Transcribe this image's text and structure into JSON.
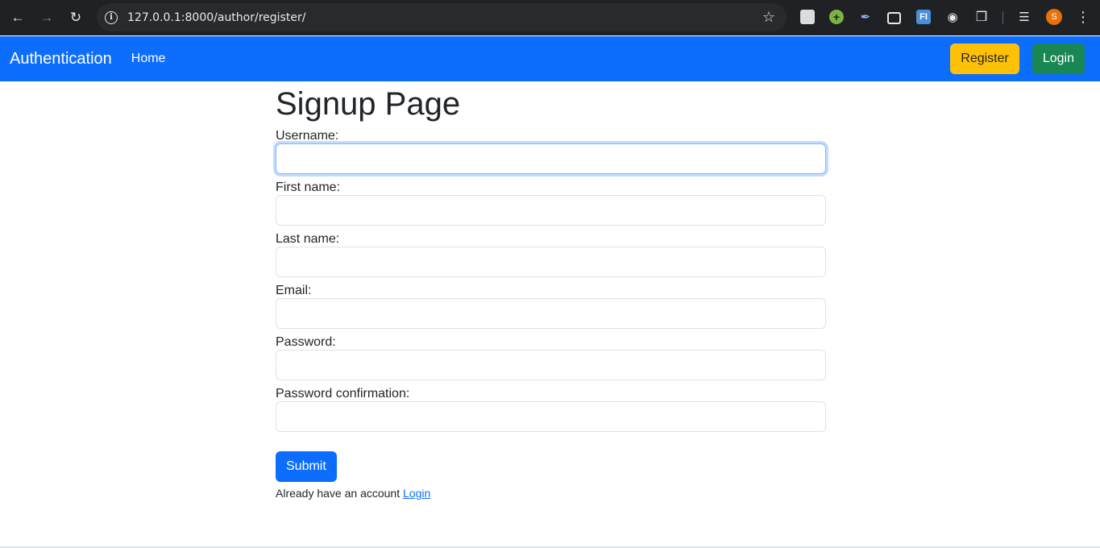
{
  "browser": {
    "url_host": "127.0.0.1",
    "url_rest": ":8000/author/register/",
    "profile_initial": "S"
  },
  "navbar": {
    "brand": "Authentication",
    "home": "Home",
    "register": "Register",
    "login": "Login"
  },
  "page": {
    "title": "Signup Page",
    "fields": [
      {
        "label": "Username:",
        "value": ""
      },
      {
        "label": "First name:",
        "value": ""
      },
      {
        "label": "Last name:",
        "value": ""
      },
      {
        "label": "Email:",
        "value": ""
      },
      {
        "label": "Password:",
        "value": ""
      },
      {
        "label": "Password confirmation:",
        "value": ""
      }
    ],
    "submit": "Submit",
    "already_text": "Already have an account",
    "login_link": "Login"
  },
  "colors": {
    "primary": "#0d6efd",
    "warning": "#ffc107",
    "success": "#198754"
  }
}
